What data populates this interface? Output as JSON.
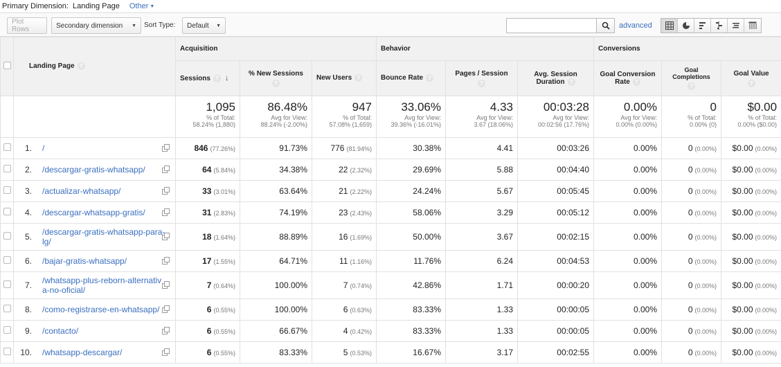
{
  "primary_dimension": {
    "label": "Primary Dimension:",
    "active": "Landing Page",
    "other": "Other"
  },
  "toolbar": {
    "plot_rows": "Plot Rows",
    "secondary_dimension": "Secondary dimension",
    "sort_type_label": "Sort Type:",
    "sort_type_value": "Default",
    "search_placeholder": "",
    "advanced": "advanced",
    "view_icons": [
      "table-view-icon",
      "pie-view-icon",
      "performance-view-icon",
      "comparison-view-icon",
      "term-cloud-view-icon",
      "pivot-view-icon"
    ]
  },
  "table": {
    "groups": {
      "acquisition": "Acquisition",
      "behavior": "Behavior",
      "conversions": "Conversions"
    },
    "dimension_header": "Landing Page",
    "columns": {
      "sessions": "Sessions",
      "new_sessions": "% New Sessions",
      "new_users": "New Users",
      "bounce_rate": "Bounce Rate",
      "pages_session": "Pages / Session",
      "avg_duration_1": "Avg. Session",
      "avg_duration_2": "Duration",
      "goal_conv_1": "Goal Conversion",
      "goal_conv_2": "Rate",
      "goal_comp_1": "Goal",
      "goal_comp_2": "Completions",
      "goal_value": "Goal Value"
    },
    "totals": {
      "sessions": {
        "value": "1,095",
        "sub1": "% of Total:",
        "sub2": "58.24% (1,880)"
      },
      "new_sessions": {
        "value": "86.48%",
        "sub1": "Avg for View:",
        "sub2": "88.24% (-2.00%)"
      },
      "new_users": {
        "value": "947",
        "sub1": "% of Total:",
        "sub2": "57.08% (1,659)"
      },
      "bounce_rate": {
        "value": "33.06%",
        "sub1": "Avg for View:",
        "sub2": "39.36% (-16.01%)"
      },
      "pages_session": {
        "value": "4.33",
        "sub1": "Avg for View:",
        "sub2": "3.67 (18.06%)"
      },
      "avg_duration": {
        "value": "00:03:28",
        "sub1": "Avg for View:",
        "sub2": "00:02:56 (17.76%)"
      },
      "goal_conv": {
        "value": "0.00%",
        "sub1": "Avg for View:",
        "sub2": "0.00% (0.00%)"
      },
      "goal_comp": {
        "value": "0",
        "sub1": "% of Total:",
        "sub2": "0.00% (0)"
      },
      "goal_value": {
        "value": "$0.00",
        "sub1": "% of Total:",
        "sub2": "0.00% ($0.00)"
      }
    },
    "rows": [
      {
        "num": "1.",
        "page": "/",
        "sessions": "846",
        "sessions_pct": "(77.26%)",
        "new_sessions": "91.73%",
        "new_users": "776",
        "new_users_pct": "(81.94%)",
        "bounce_rate": "30.38%",
        "pages_session": "4.41",
        "avg_duration": "00:03:26",
        "goal_conv": "0.00%",
        "goal_comp": "0",
        "goal_comp_pct": "(0.00%)",
        "goal_value": "$0.00",
        "goal_value_pct": "(0.00%)"
      },
      {
        "num": "2.",
        "page": "/descargar-gratis-whatsapp/",
        "sessions": "64",
        "sessions_pct": "(5.84%)",
        "new_sessions": "34.38%",
        "new_users": "22",
        "new_users_pct": "(2.32%)",
        "bounce_rate": "29.69%",
        "pages_session": "5.88",
        "avg_duration": "00:04:40",
        "goal_conv": "0.00%",
        "goal_comp": "0",
        "goal_comp_pct": "(0.00%)",
        "goal_value": "$0.00",
        "goal_value_pct": "(0.00%)"
      },
      {
        "num": "3.",
        "page": "/actualizar-whatsapp/",
        "sessions": "33",
        "sessions_pct": "(3.01%)",
        "new_sessions": "63.64%",
        "new_users": "21",
        "new_users_pct": "(2.22%)",
        "bounce_rate": "24.24%",
        "pages_session": "5.67",
        "avg_duration": "00:05:45",
        "goal_conv": "0.00%",
        "goal_comp": "0",
        "goal_comp_pct": "(0.00%)",
        "goal_value": "$0.00",
        "goal_value_pct": "(0.00%)"
      },
      {
        "num": "4.",
        "page": "/descargar-whatsapp-gratis/",
        "sessions": "31",
        "sessions_pct": "(2.83%)",
        "new_sessions": "74.19%",
        "new_users": "23",
        "new_users_pct": "(2.43%)",
        "bounce_rate": "58.06%",
        "pages_session": "3.29",
        "avg_duration": "00:05:12",
        "goal_conv": "0.00%",
        "goal_comp": "0",
        "goal_comp_pct": "(0.00%)",
        "goal_value": "$0.00",
        "goal_value_pct": "(0.00%)"
      },
      {
        "num": "5.",
        "page": "/descargar-gratis-whatsapp-para-lg/",
        "sessions": "18",
        "sessions_pct": "(1.64%)",
        "new_sessions": "88.89%",
        "new_users": "16",
        "new_users_pct": "(1.69%)",
        "bounce_rate": "50.00%",
        "pages_session": "3.67",
        "avg_duration": "00:02:15",
        "goal_conv": "0.00%",
        "goal_comp": "0",
        "goal_comp_pct": "(0.00%)",
        "goal_value": "$0.00",
        "goal_value_pct": "(0.00%)"
      },
      {
        "num": "6.",
        "page": "/bajar-gratis-whatsapp/",
        "sessions": "17",
        "sessions_pct": "(1.55%)",
        "new_sessions": "64.71%",
        "new_users": "11",
        "new_users_pct": "(1.16%)",
        "bounce_rate": "11.76%",
        "pages_session": "6.24",
        "avg_duration": "00:04:53",
        "goal_conv": "0.00%",
        "goal_comp": "0",
        "goal_comp_pct": "(0.00%)",
        "goal_value": "$0.00",
        "goal_value_pct": "(0.00%)"
      },
      {
        "num": "7.",
        "page": "/whatsapp-plus-reborn-alternativa-no-oficial/",
        "sessions": "7",
        "sessions_pct": "(0.64%)",
        "new_sessions": "100.00%",
        "new_users": "7",
        "new_users_pct": "(0.74%)",
        "bounce_rate": "42.86%",
        "pages_session": "1.71",
        "avg_duration": "00:00:20",
        "goal_conv": "0.00%",
        "goal_comp": "0",
        "goal_comp_pct": "(0.00%)",
        "goal_value": "$0.00",
        "goal_value_pct": "(0.00%)"
      },
      {
        "num": "8.",
        "page": "/como-registrarse-en-whatsapp/",
        "sessions": "6",
        "sessions_pct": "(0.55%)",
        "new_sessions": "100.00%",
        "new_users": "6",
        "new_users_pct": "(0.63%)",
        "bounce_rate": "83.33%",
        "pages_session": "1.33",
        "avg_duration": "00:00:05",
        "goal_conv": "0.00%",
        "goal_comp": "0",
        "goal_comp_pct": "(0.00%)",
        "goal_value": "$0.00",
        "goal_value_pct": "(0.00%)"
      },
      {
        "num": "9.",
        "page": "/contacto/",
        "sessions": "6",
        "sessions_pct": "(0.55%)",
        "new_sessions": "66.67%",
        "new_users": "4",
        "new_users_pct": "(0.42%)",
        "bounce_rate": "83.33%",
        "pages_session": "1.33",
        "avg_duration": "00:00:05",
        "goal_conv": "0.00%",
        "goal_comp": "0",
        "goal_comp_pct": "(0.00%)",
        "goal_value": "$0.00",
        "goal_value_pct": "(0.00%)"
      },
      {
        "num": "10.",
        "page": "/whatsapp-descargar/",
        "sessions": "6",
        "sessions_pct": "(0.55%)",
        "new_sessions": "83.33%",
        "new_users": "5",
        "new_users_pct": "(0.53%)",
        "bounce_rate": "16.67%",
        "pages_session": "3.17",
        "avg_duration": "00:02:55",
        "goal_conv": "0.00%",
        "goal_comp": "0",
        "goal_comp_pct": "(0.00%)",
        "goal_value": "$0.00",
        "goal_value_pct": "(0.00%)"
      }
    ]
  }
}
